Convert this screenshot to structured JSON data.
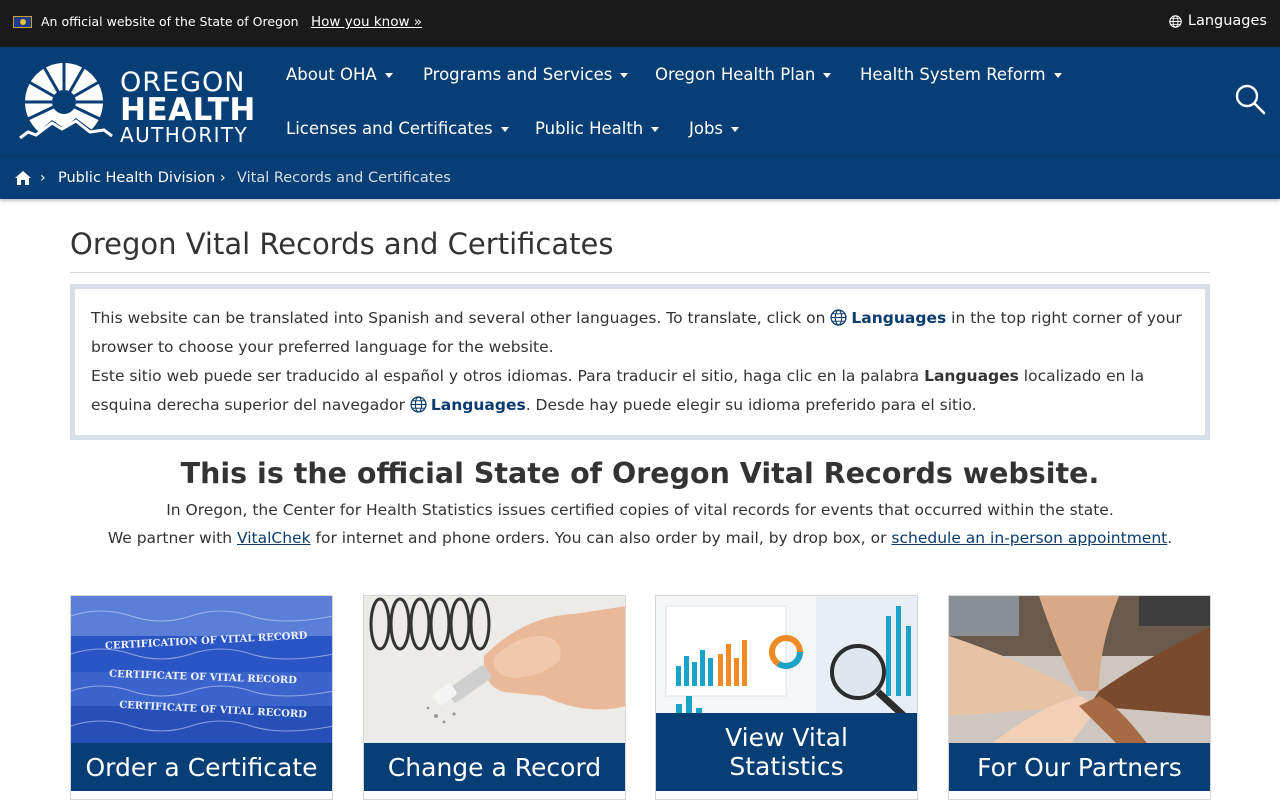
{
  "gov_banner": {
    "official_text": "An official website of the State of Oregon",
    "how_you_know": "How you know »",
    "languages": "Languages"
  },
  "logo": {
    "line1": "OREGON",
    "line2": "HEALTH",
    "line3": "AUTHORITY"
  },
  "nav": {
    "items": [
      {
        "label": "About OHA"
      },
      {
        "label": "Programs and Services"
      },
      {
        "label": "Oregon Health Plan"
      },
      {
        "label": "Health System Reform"
      },
      {
        "label": "Licenses and Certificates"
      },
      {
        "label": "Public Health"
      },
      {
        "label": "Jobs"
      }
    ]
  },
  "breadcrumb": {
    "items": [
      {
        "label": "Public Health Division"
      },
      {
        "label": "Vital Records and Certificates"
      }
    ]
  },
  "page": {
    "title": "Oregon Vital Records and Certificates"
  },
  "notice": {
    "en_part1": "This website can be translated into Spanish and several other languages. To translate, click on ",
    "en_link": "Languages",
    "en_part2": " in the top right corner of your browser to choose your preferred language for the website.",
    "es_part1": "Este sitio web puede ser traducido al español y otros idiomas. Para traducir el sitio, haga clic en la palabra ",
    "es_bold": "Languages",
    "es_part2": " localizado en la esquina derecha superior del navegador ",
    "es_link": "Languages",
    "es_part3": ". Desde hay puede elegir su idioma preferido para el sitio."
  },
  "intro": {
    "heading": "This is the official State of Oregon Vital Records website.",
    "line1": "In Oregon, the Center for Health Statistics issues certified copies of vital records for events that occurred within the state.",
    "line2_part1": "We partner with ",
    "vitalchek_link": "VitalChek",
    "line2_part2": " for internet and phone orders. You can also order by mail, by drop box, or ",
    "appointment_link": "schedule an in-person appointment",
    "line2_part3": "."
  },
  "cards": [
    {
      "label": "Order a Certificate",
      "image_text": [
        "CERTIFICATION OF VITAL RECORD",
        "CERTIFICATE OF VITAL RECORD",
        "CERTIFICATE OF VITAL RECORD"
      ]
    },
    {
      "label": "Change a Record"
    },
    {
      "label": "View Vital Statistics",
      "label_line1": "View Vital",
      "label_line2": "Statistics"
    },
    {
      "label": "For Our Partners"
    }
  ],
  "colors": {
    "header_blue": "#073e75",
    "gov_bar": "#1a1a1a",
    "link_blue": "#0b3b6e",
    "notice_border": "#d9dfe8"
  },
  "icons": {
    "search": "search-icon",
    "home": "home-icon",
    "globe": "globe-icon",
    "caret": "caret-down-icon",
    "chevron": "chevron-right-icon"
  }
}
